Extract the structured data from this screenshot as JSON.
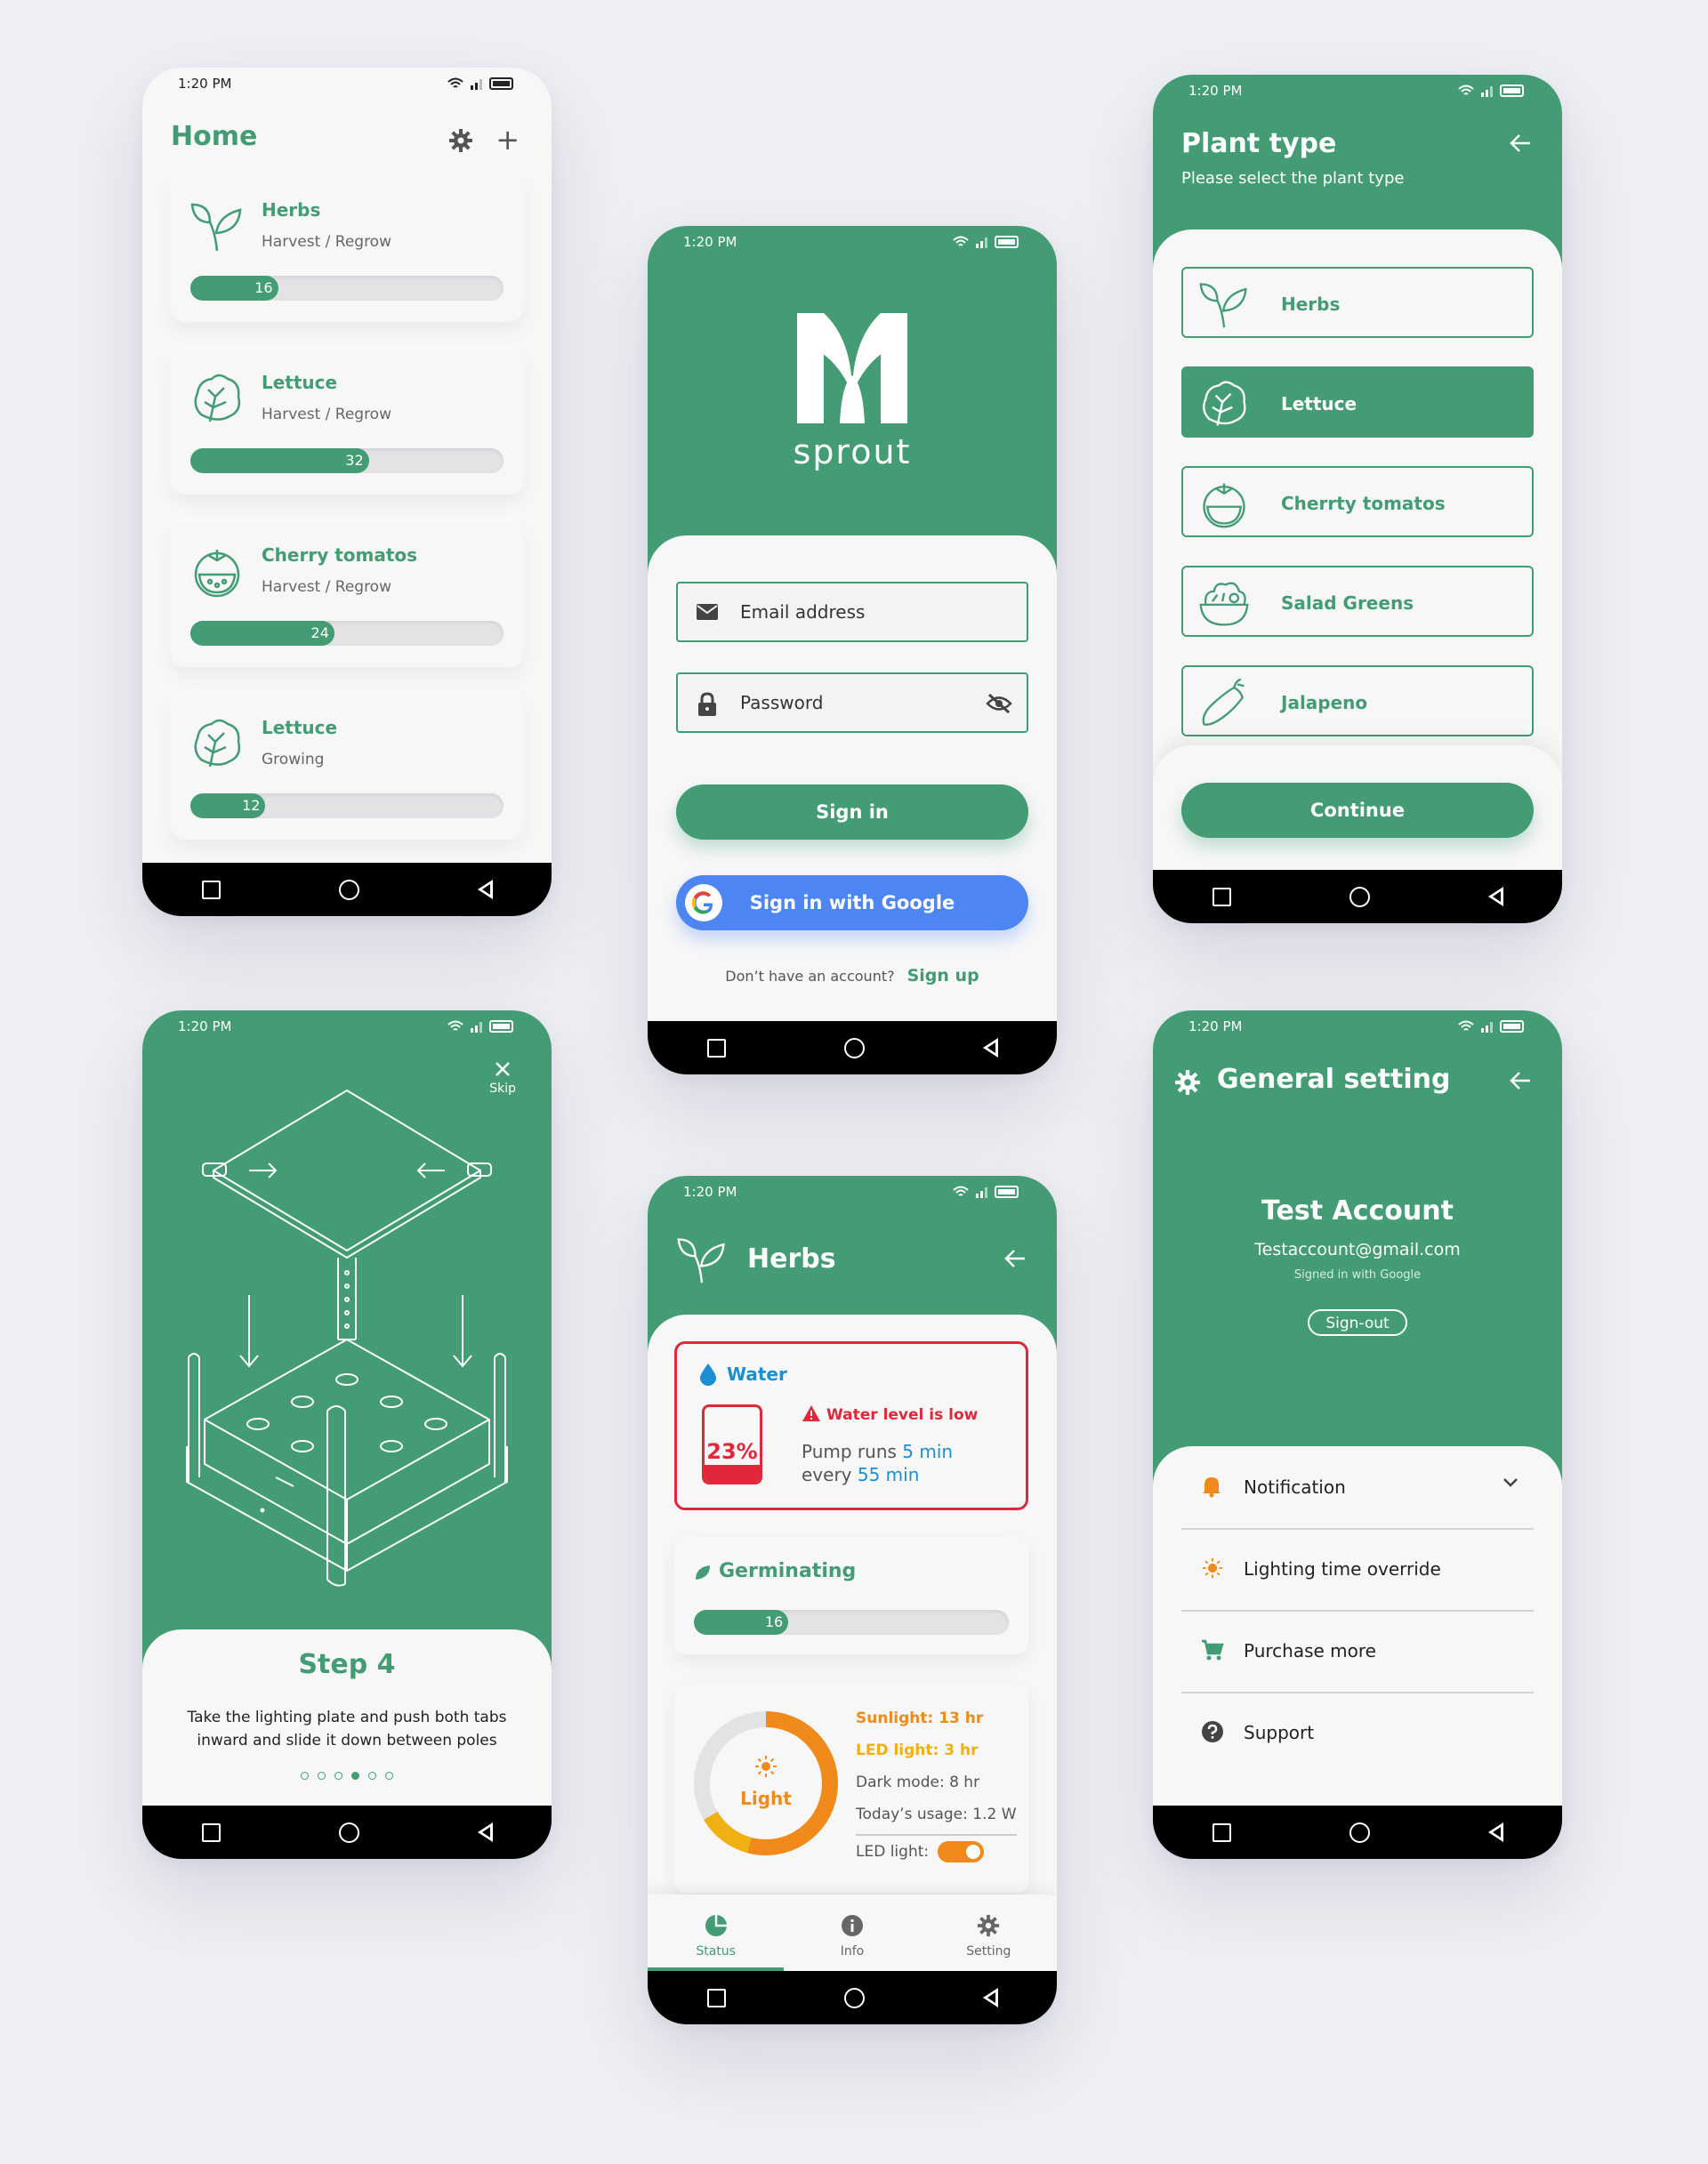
{
  "status_time": "1:20 PM",
  "home": {
    "title": "Home",
    "plants": [
      {
        "name": "Herbs",
        "status": "Harvest / Regrow",
        "days": "16",
        "progress": 0.28
      },
      {
        "name": "Lettuce",
        "status": "Harvest / Regrow",
        "days": "32",
        "progress": 0.57
      },
      {
        "name": "Cherry tomatos",
        "status": "Harvest / Regrow",
        "days": "24",
        "progress": 0.46
      },
      {
        "name": "Lettuce",
        "status": "Growing",
        "days": "12",
        "progress": 0.24
      }
    ]
  },
  "login": {
    "brand": "sprout",
    "email_label": "Email address",
    "password_label": "Password",
    "sign_in": "Sign in",
    "google_sign_in": "Sign in with Google",
    "no_account": "Don’t have an account?",
    "sign_up": "Sign up"
  },
  "plant_type": {
    "title": "Plant type",
    "subtitle": "Please select the plant type",
    "options": [
      "Herbs",
      "Lettuce",
      "Cherrty tomatos",
      "Salad Greens",
      "Jalapeno"
    ],
    "selected": "Lettuce",
    "continue": "Continue"
  },
  "step": {
    "skip": "Skip",
    "title": "Step 4",
    "text": "Take the lighting plate and push both tabs inward and slide it down between poles",
    "current": 4,
    "total": 6
  },
  "herbs_detail": {
    "title": "Herbs",
    "water": {
      "title": "Water",
      "percent": "23%",
      "level": 0.23,
      "warning": "Water level is low",
      "pump_prefix": "Pump runs",
      "pump_duration": "5 min",
      "pump_every_prefix": "every",
      "pump_interval": "55 min"
    },
    "germinating": {
      "title": "Germinating",
      "days": "16",
      "progress": 0.3
    },
    "light": {
      "label": "Light",
      "sunlight": "Sunlight: 13 hr",
      "led": "LED light: 3 hr",
      "dark": "Dark mode: 8 hr",
      "usage": "Today’s usage: 1.2 W",
      "led_toggle_label": "LED light:",
      "led_on": true
    },
    "tabs": [
      "Status",
      "Info",
      "Setting"
    ],
    "active_tab": "Status"
  },
  "settings": {
    "title": "General setting",
    "account_name": "Test Account",
    "email": "Testaccount@gmail.com",
    "note": "Signed in with Google",
    "sign_out": "Sign-out",
    "items": [
      "Notification",
      "Lighting time override",
      "Purchase more",
      "Support"
    ]
  },
  "colors": {
    "brand": "#439c74",
    "water": "#1c8fd3",
    "alert": "#e0283a",
    "sun": "#f08a1a",
    "led": "#f0b014",
    "google": "#4d86f2"
  }
}
